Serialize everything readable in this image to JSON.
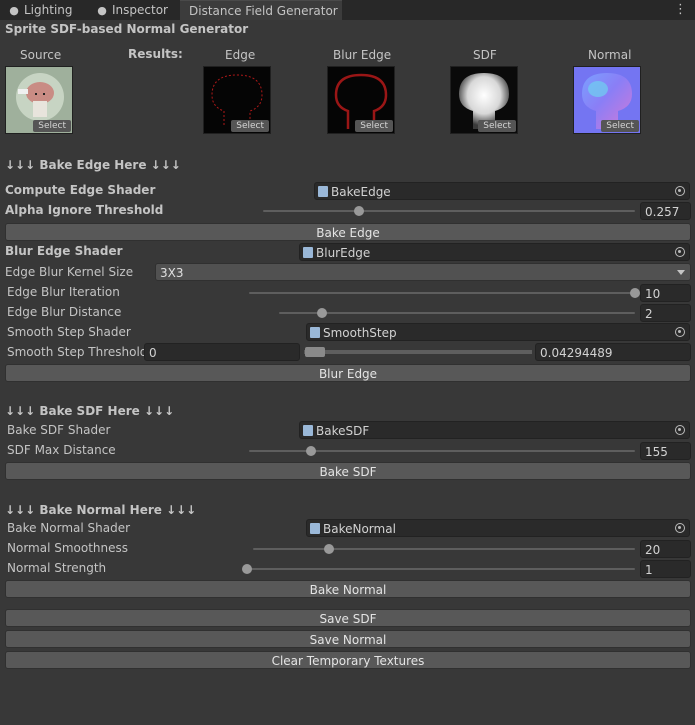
{
  "tabs": [
    {
      "label": "Lighting",
      "icon": "bulb-icon"
    },
    {
      "label": "Inspector",
      "icon": "info-icon"
    },
    {
      "label": "Distance Field Generator",
      "icon": ""
    }
  ],
  "window_menu": "⋮",
  "title": "Sprite SDF-based Normal Generator",
  "thumbnails": {
    "source_label": "Source",
    "results_label": "Results:",
    "edge_label": "Edge",
    "blur_edge_label": "Blur Edge",
    "sdf_label": "SDF",
    "normal_label": "Normal",
    "select_label": "Select"
  },
  "edge_section": {
    "header": "↓↓↓ Bake Edge Here ↓↓↓",
    "compute_shader_label": "Compute Edge Shader",
    "compute_shader_value": "BakeEdge",
    "alpha_label": "Alpha Ignore Threshold",
    "alpha_value": "0.257",
    "alpha_fraction": 0.257,
    "bake_button": "Bake Edge"
  },
  "blur_section": {
    "shader_label": "Blur Edge Shader",
    "shader_value": "BlurEdge",
    "kernel_label": "Edge Blur Kernel Size",
    "kernel_value": "3X3",
    "iteration_label": "Edge Blur Iteration",
    "iteration_value": "10",
    "iteration_fraction": 1.0,
    "distance_label": "Edge Blur Distance",
    "distance_value": "2",
    "distance_fraction": 0.12,
    "smooth_shader_label": "Smooth Step Shader",
    "smooth_shader_value": "SmoothStep",
    "smooth_threshold_label": "Smooth Step Threshold",
    "smooth_threshold_min": "0",
    "smooth_threshold_max": "0.04294489",
    "blur_button": "Blur Edge"
  },
  "sdf_section": {
    "header": "↓↓↓ Bake SDF Here ↓↓↓",
    "shader_label": "Bake SDF Shader",
    "shader_value": "BakeSDF",
    "max_distance_label": "SDF Max Distance",
    "max_distance_value": "155",
    "max_distance_fraction": 0.16,
    "bake_button": "Bake SDF"
  },
  "normal_section": {
    "header": "↓↓↓ Bake Normal Here ↓↓↓",
    "shader_label": "Bake Normal Shader",
    "shader_value": "BakeNormal",
    "smoothness_label": "Normal Smoothness",
    "smoothness_value": "20",
    "smoothness_fraction": 0.2,
    "strength_label": "Normal Strength",
    "strength_value": "1",
    "strength_fraction": 0.0,
    "bake_button": "Bake Normal"
  },
  "footer_buttons": {
    "save_sdf": "Save SDF",
    "save_normal": "Save Normal",
    "clear": "Clear Temporary Textures"
  }
}
